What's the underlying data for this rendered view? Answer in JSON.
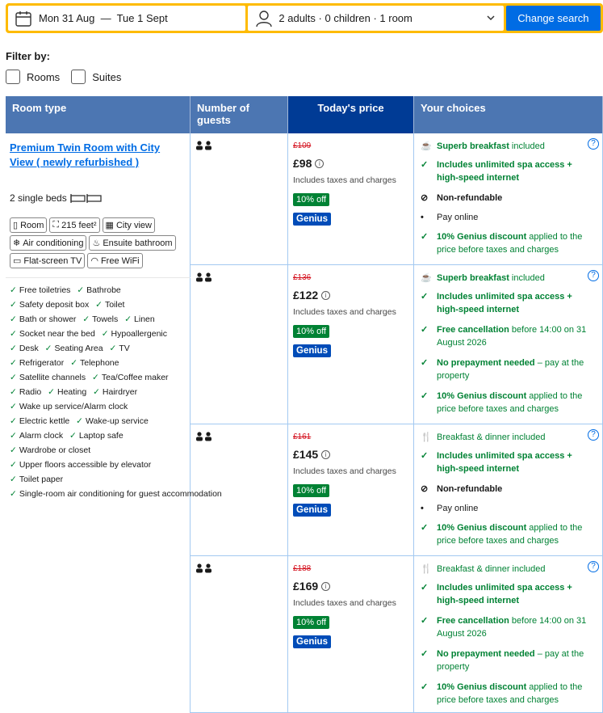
{
  "search": {
    "dates": "Mon 31 Aug  —  Tue 1 Sept",
    "guests": "2 adults · 0 children · 1 room",
    "button": "Change search"
  },
  "filter": {
    "label": "Filter by:",
    "options": [
      "Rooms",
      "Suites"
    ]
  },
  "table": {
    "headers": [
      "Room type",
      "Number of guests",
      "Today's price",
      "Your choices"
    ]
  },
  "room": {
    "name": "Premium Twin Room with City View ( newly refurbished )",
    "beds": "2 single beds",
    "chips": [
      "Room",
      "215 feet²",
      "City view",
      "Air conditioning",
      "Ensuite bathroom",
      "Flat-screen TV",
      "Free WiFi"
    ],
    "amenities": [
      "Free toiletries",
      "Bathrobe",
      "Safety deposit box",
      "Toilet",
      "Bath or shower",
      "Towels",
      "Linen",
      "Socket near the bed",
      "Hypoallergenic",
      "Desk",
      "Seating Area",
      "TV",
      "Refrigerator",
      "Telephone",
      "Satellite channels",
      "Tea/Coffee maker",
      "Radio",
      "Heating",
      "Hairdryer",
      "Wake up service/Alarm clock",
      "Electric kettle",
      "Wake-up service",
      "Alarm clock",
      "Laptop safe",
      "Wardrobe or closet",
      "Upper floors accessible by elevator",
      "Toilet paper",
      "Single-room air conditioning for guest accommodation"
    ]
  },
  "offers": [
    {
      "old": "£109",
      "price": "£98",
      "taxes": "Includes taxes and charges",
      "off": "10% off",
      "genius": "Genius",
      "choices": [
        {
          "icon": "coffee-icon",
          "bold": "Superb breakfast",
          "rest": " included"
        },
        {
          "icon": "check-icon",
          "bold": "Includes unlimited spa access + high-speed internet",
          "rest": ""
        },
        {
          "icon": "no-refund-icon",
          "bold": "Non-refundable",
          "rest": ""
        },
        {
          "icon": "bullet-icon",
          "bold": "",
          "rest": "Pay online"
        },
        {
          "icon": "check-icon",
          "bold": "10% Genius discount",
          "rest": " applied to the price before taxes and charges"
        }
      ]
    },
    {
      "old": "£136",
      "price": "£122",
      "taxes": "Includes taxes and charges",
      "off": "10% off",
      "genius": "Genius",
      "choices": [
        {
          "icon": "coffee-icon",
          "bold": "Superb breakfast",
          "rest": " included"
        },
        {
          "icon": "check-icon",
          "bold": "Includes unlimited spa access + high-speed internet",
          "rest": ""
        },
        {
          "icon": "check-icon",
          "bold": "Free cancellation",
          "rest": " before 14:00 on 31 August 2026"
        },
        {
          "icon": "check-icon",
          "bold": "No prepayment needed",
          "rest": " – pay at the property"
        },
        {
          "icon": "check-icon",
          "bold": "10% Genius discount",
          "rest": " applied to the price before taxes and charges"
        }
      ]
    },
    {
      "old": "£161",
      "price": "£145",
      "taxes": "Includes taxes and charges",
      "off": "10% off",
      "genius": "Genius",
      "choices": [
        {
          "icon": "cutlery-icon",
          "bold": "",
          "rest": "Breakfast & dinner included"
        },
        {
          "icon": "check-icon",
          "bold": "Includes unlimited spa access + high-speed internet",
          "rest": ""
        },
        {
          "icon": "no-refund-icon",
          "bold": "Non-refundable",
          "rest": ""
        },
        {
          "icon": "bullet-icon",
          "bold": "",
          "rest": "Pay online"
        },
        {
          "icon": "check-icon",
          "bold": "10% Genius discount",
          "rest": " applied to the price before taxes and charges"
        }
      ]
    },
    {
      "old": "£188",
      "price": "£169",
      "taxes": "Includes taxes and charges",
      "off": "10% off",
      "genius": "Genius",
      "choices": [
        {
          "icon": "cutlery-icon",
          "bold": "",
          "rest": "Breakfast & dinner included"
        },
        {
          "icon": "check-icon",
          "bold": "Includes unlimited spa access + high-speed internet",
          "rest": ""
        },
        {
          "icon": "check-icon",
          "bold": "Free cancellation",
          "rest": " before 14:00 on 31 August 2026"
        },
        {
          "icon": "check-icon",
          "bold": "No prepayment needed",
          "rest": " – pay at the property"
        },
        {
          "icon": "check-icon",
          "bold": "10% Genius discount",
          "rest": " applied to the price before taxes and charges"
        }
      ]
    }
  ]
}
